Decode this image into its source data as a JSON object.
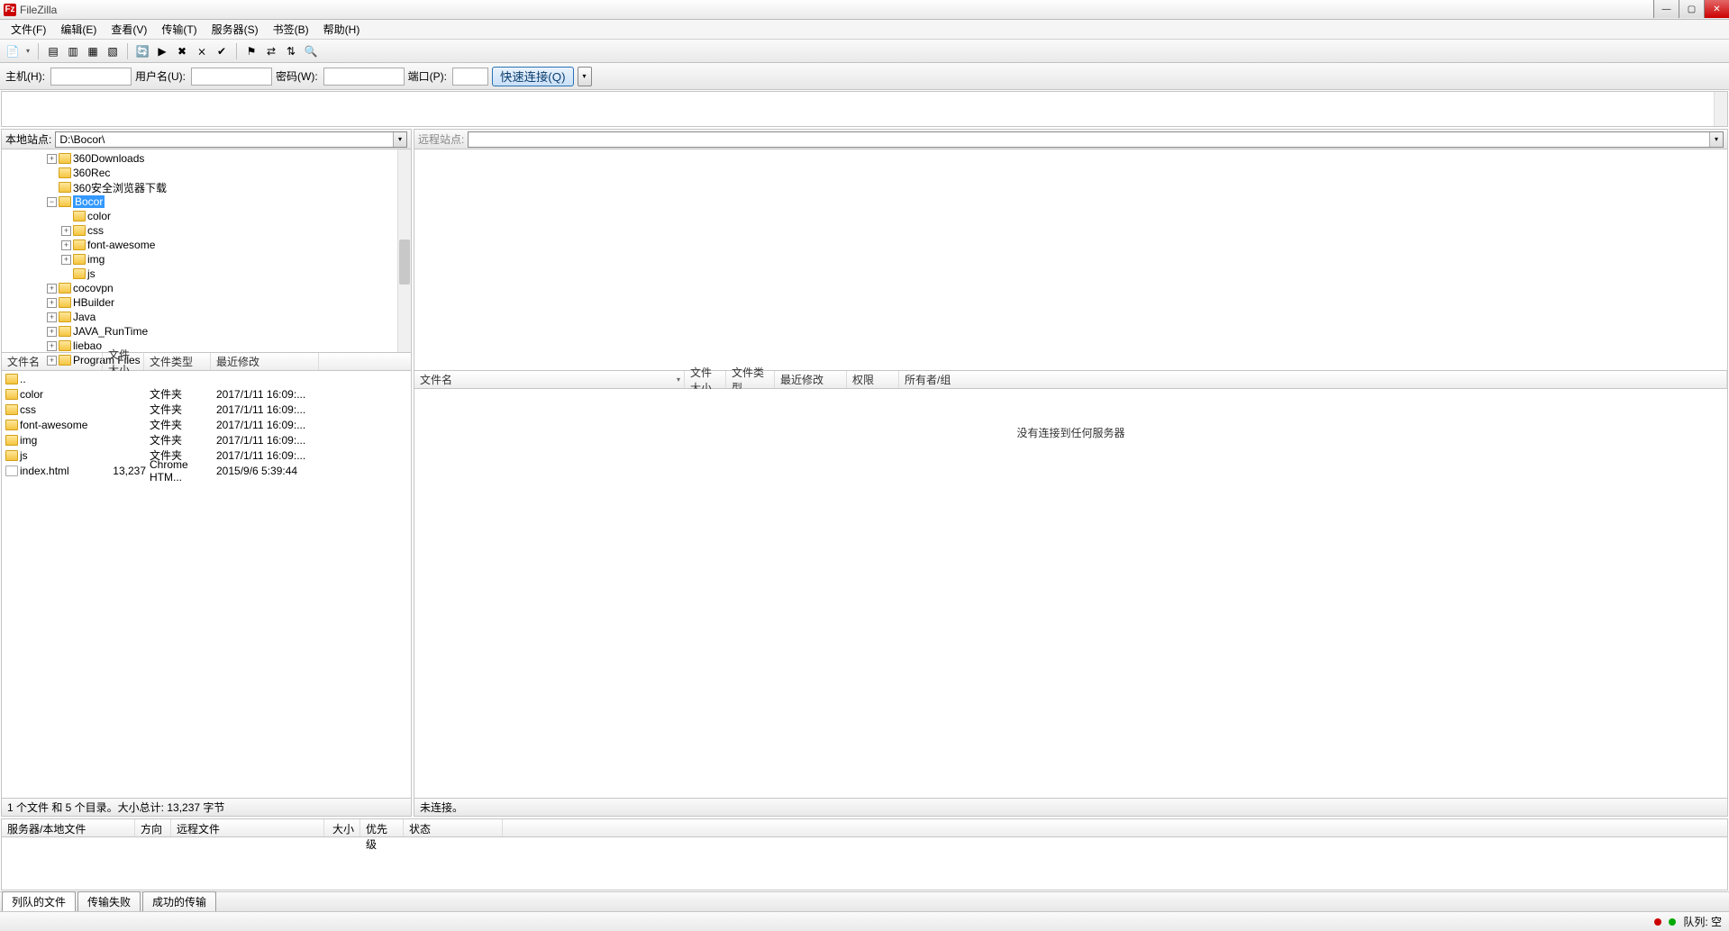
{
  "title": "FileZilla",
  "app_icon": "Fz",
  "menus": [
    "文件(F)",
    "编辑(E)",
    "查看(V)",
    "传输(T)",
    "服务器(S)",
    "书签(B)",
    "帮助(H)"
  ],
  "quickconnect": {
    "host_label": "主机(H):",
    "user_label": "用户名(U):",
    "pass_label": "密码(W):",
    "port_label": "端口(P):",
    "btn": "快速连接(Q)"
  },
  "local_site_label": "本地站点:",
  "local_site_path": "D:\\Bocor\\",
  "remote_site_label": "远程站点:",
  "tree": [
    {
      "lvl": 1,
      "exp": "+",
      "name": "360Downloads"
    },
    {
      "lvl": 1,
      "exp": "",
      "name": "360Rec"
    },
    {
      "lvl": 1,
      "exp": "",
      "name": "360安全浏览器下载"
    },
    {
      "lvl": 1,
      "exp": "-",
      "name": "Bocor",
      "sel": true
    },
    {
      "lvl": 2,
      "exp": "",
      "name": "color"
    },
    {
      "lvl": 2,
      "exp": "+",
      "name": "css"
    },
    {
      "lvl": 2,
      "exp": "+",
      "name": "font-awesome"
    },
    {
      "lvl": 2,
      "exp": "+",
      "name": "img"
    },
    {
      "lvl": 2,
      "exp": "",
      "name": "js"
    },
    {
      "lvl": 1,
      "exp": "+",
      "name": "cocovpn"
    },
    {
      "lvl": 1,
      "exp": "+",
      "name": "HBuilder"
    },
    {
      "lvl": 1,
      "exp": "+",
      "name": "Java"
    },
    {
      "lvl": 1,
      "exp": "+",
      "name": "JAVA_RunTime"
    },
    {
      "lvl": 1,
      "exp": "+",
      "name": "liebao"
    },
    {
      "lvl": 1,
      "exp": "+",
      "name": "Program Files"
    }
  ],
  "local_cols": {
    "name": "文件名",
    "size": "文件大小",
    "type": "文件类型",
    "date": "最近修改"
  },
  "remote_cols": {
    "name": "文件名",
    "size": "文件大小",
    "type": "文件类型",
    "date": "最近修改",
    "perm": "权限",
    "owner": "所有者/组"
  },
  "local_files": [
    {
      "icon": "folder",
      "name": "..",
      "size": "",
      "type": "",
      "date": ""
    },
    {
      "icon": "folder",
      "name": "color",
      "size": "",
      "type": "文件夹",
      "date": "2017/1/11 16:09:..."
    },
    {
      "icon": "folder",
      "name": "css",
      "size": "",
      "type": "文件夹",
      "date": "2017/1/11 16:09:..."
    },
    {
      "icon": "folder",
      "name": "font-awesome",
      "size": "",
      "type": "文件夹",
      "date": "2017/1/11 16:09:..."
    },
    {
      "icon": "folder",
      "name": "img",
      "size": "",
      "type": "文件夹",
      "date": "2017/1/11 16:09:..."
    },
    {
      "icon": "folder",
      "name": "js",
      "size": "",
      "type": "文件夹",
      "date": "2017/1/11 16:09:..."
    },
    {
      "icon": "file",
      "name": "index.html",
      "size": "13,237",
      "type": "Chrome HTM...",
      "date": "2015/9/6 5:39:44"
    }
  ],
  "remote_empty_msg": "没有连接到任何服务器",
  "local_status": "1 个文件 和 5 个目录。大小总计: 13,237 字节",
  "remote_status": "未连接。",
  "transfer_cols": {
    "srv": "服务器/本地文件",
    "dir": "方向",
    "remote": "远程文件",
    "size": "大小",
    "prio": "优先级",
    "status": "状态"
  },
  "tabs": [
    "列队的文件",
    "传输失败",
    "成功的传输"
  ],
  "queue_label": "队列: 空"
}
